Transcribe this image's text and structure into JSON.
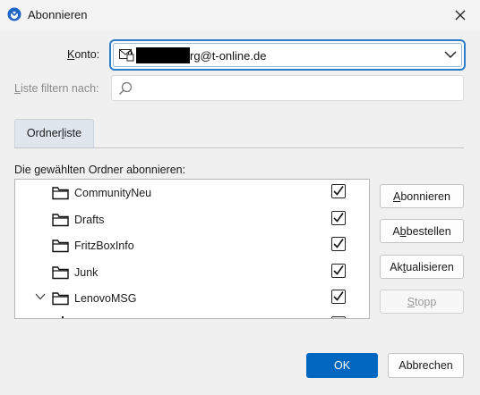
{
  "window": {
    "title": "Abonnieren"
  },
  "account": {
    "label_pre": "",
    "label_ul": "K",
    "label_post": "onto:",
    "value_suffix": "rg@t-online.de"
  },
  "filter": {
    "label_ul": "L",
    "label_post": "iste filtern nach:",
    "value": "",
    "placeholder": ""
  },
  "tabs": [
    {
      "label_pre": "Ordner",
      "label_ul": "l",
      "label_post": "iste"
    }
  ],
  "list_label": "Die gewählten Ordner abonnieren:",
  "folders": [
    {
      "name": "CommunityNeu",
      "checked": true,
      "expanded": null
    },
    {
      "name": "Drafts",
      "checked": true,
      "expanded": null
    },
    {
      "name": "FritzBoxInfo",
      "checked": true,
      "expanded": null
    },
    {
      "name": "Junk",
      "checked": true,
      "expanded": null
    },
    {
      "name": "LenovoMSG",
      "checked": true,
      "expanded": true
    }
  ],
  "side_buttons": {
    "subscribe": {
      "ul": "A",
      "rest": "bonnieren"
    },
    "unsubscribe": {
      "pre": "A",
      "ul": "b",
      "rest": "bestellen"
    },
    "refresh": {
      "pre": "Ak",
      "ul": "t",
      "rest": "ualisieren"
    },
    "stop": {
      "ul": "S",
      "rest": "topp"
    }
  },
  "footer": {
    "ok": "OK",
    "cancel": "Abbrechen"
  },
  "colors": {
    "accent": "#0067c0",
    "focus_border": "#2b7cc6",
    "app_icon": "#1f66c9"
  },
  "icons": {
    "app": "thunderbird-icon",
    "close": "close-icon",
    "account": "email-account-icon",
    "dropdown": "chevron-down-icon",
    "search": "search-icon",
    "folder": "folder-icon",
    "twisty": "chevron-expanded-icon",
    "checkbox": "checkmark-icon"
  }
}
